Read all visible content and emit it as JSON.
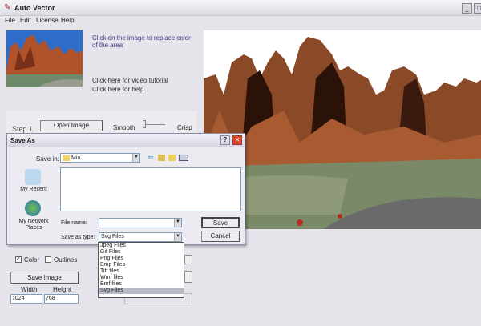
{
  "app": {
    "title": "Auto Vector",
    "minimize": "_",
    "maximize": "□"
  },
  "menu": [
    "File",
    "Edit",
    "License",
    "Help"
  ],
  "links": {
    "replace_color": "Click on the image to replace color of the area",
    "video": "Click here for video tutorial",
    "help": "Click here for help"
  },
  "step": {
    "label": "Step 1",
    "open": "Open Image",
    "smooth": "Smooth",
    "crisp": "Crisp"
  },
  "dialog": {
    "title": "Save As",
    "help": "?",
    "close": "✕",
    "save_in_label": "Save in:",
    "save_in_value": "Mia",
    "places": [
      "My Recent",
      "My Network Places"
    ],
    "file_name_label": "File name:",
    "file_name_value": "",
    "type_label": "Save as type:",
    "type_value": "Svg Files",
    "save": "Save",
    "cancel": "Cancel",
    "type_options": [
      "Jpeg Files",
      "Gif Files",
      "Png Files",
      "Bmp Files",
      "Tiff files",
      "Wmf files",
      "Emf files",
      "Svg Files"
    ]
  },
  "options": {
    "color": "Color",
    "color_checked": true,
    "outlines": "Outlines",
    "outlines_checked": false,
    "save_image": "Save Image",
    "width_label": "Width",
    "height_label": "Height",
    "width": "1024",
    "height": "768"
  }
}
